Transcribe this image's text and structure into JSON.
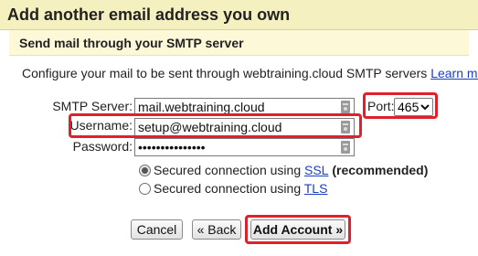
{
  "dialog": {
    "title": "Add another email address you own",
    "section_title": "Send mail through your SMTP server",
    "intro_text": "Configure your mail to be sent through webtraining.cloud SMTP servers",
    "learn_more": "Learn more"
  },
  "form": {
    "smtp_server_label": "SMTP Server:",
    "smtp_server_value": "mail.webtraining.cloud",
    "port_label": "Port:",
    "port_value": "465",
    "username_label": "Username:",
    "username_value": "setup@webtraining.cloud",
    "password_label": "Password:",
    "password_value": "•••••••••••••••"
  },
  "security": {
    "ssl_prefix": "Secured connection using ",
    "ssl_link": "SSL",
    "ssl_suffix": " (recommended)",
    "ssl_checked": true,
    "tls_prefix": "Secured connection using ",
    "tls_link": "TLS",
    "tls_checked": false
  },
  "buttons": {
    "cancel": "Cancel",
    "back": "« Back",
    "add_account": "Add Account »"
  },
  "colors": {
    "title_bg": "#f5f0c0",
    "section_bg": "#fcf8d8",
    "link": "#1a3fc4",
    "highlight": "#e0202a"
  },
  "icons": [
    "password-manager-key-icon",
    "chevron-down-icon"
  ]
}
